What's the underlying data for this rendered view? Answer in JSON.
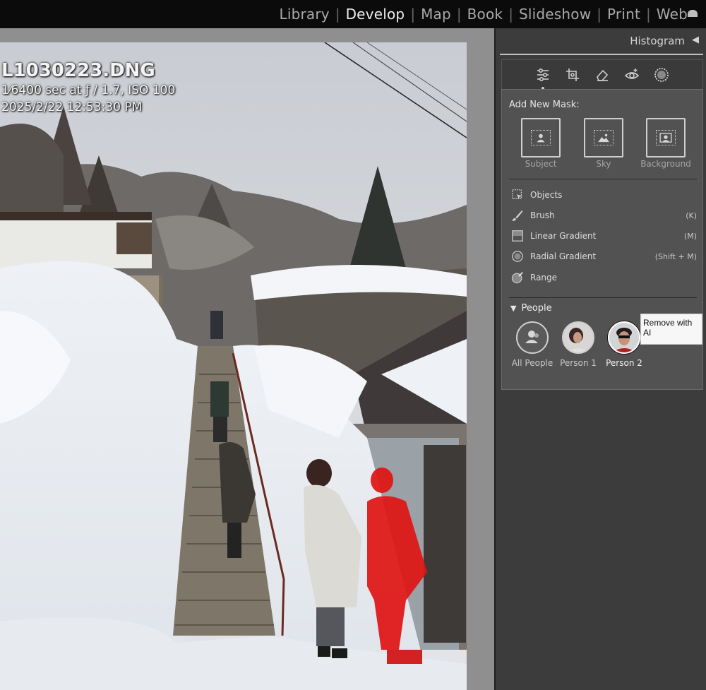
{
  "modules": {
    "items": [
      "Library",
      "Develop",
      "Map",
      "Book",
      "Slideshow",
      "Print",
      "Web"
    ],
    "active": "Develop"
  },
  "photo_info": {
    "filename": "L1030223.DNG",
    "exposure": "1⁄6400 sec at ƒ / 1.7, ISO 100",
    "date": "2025/2/22 12:53:30 PM"
  },
  "histogram": {
    "label": "Histogram",
    "arrow": "◀"
  },
  "tools": [
    {
      "icon": "edit-sliders-icon"
    },
    {
      "icon": "crop-icon"
    },
    {
      "icon": "eraser-icon"
    },
    {
      "icon": "redeye-icon"
    },
    {
      "icon": "masking-icon"
    }
  ],
  "masking": {
    "add_new_mask_label": "Add New Mask:",
    "tiles": [
      "Subject",
      "Sky",
      "Background"
    ],
    "rows": [
      {
        "label": "Objects",
        "shortcut": "",
        "icon": "objects-icon"
      },
      {
        "label": "Brush",
        "shortcut": "(K)",
        "icon": "brush-icon"
      },
      {
        "label": "Linear Gradient",
        "shortcut": "(M)",
        "icon": "linear-gradient-icon"
      },
      {
        "label": "Radial Gradient",
        "shortcut": "(Shift + M)",
        "icon": "radial-gradient-icon"
      },
      {
        "label": "Range",
        "shortcut": "",
        "icon": "range-icon"
      }
    ],
    "people_label": "People",
    "people": [
      "All People",
      "Person 1",
      "Person 2"
    ],
    "selected_person": "Person 2"
  },
  "tooltip": {
    "text": "Remove with AI"
  },
  "colors": {
    "mask_overlay": "#e01414",
    "panel_bg": "#3c3c3c",
    "mask_panel_bg": "#525252",
    "module_bar": "#0b0b0b"
  }
}
